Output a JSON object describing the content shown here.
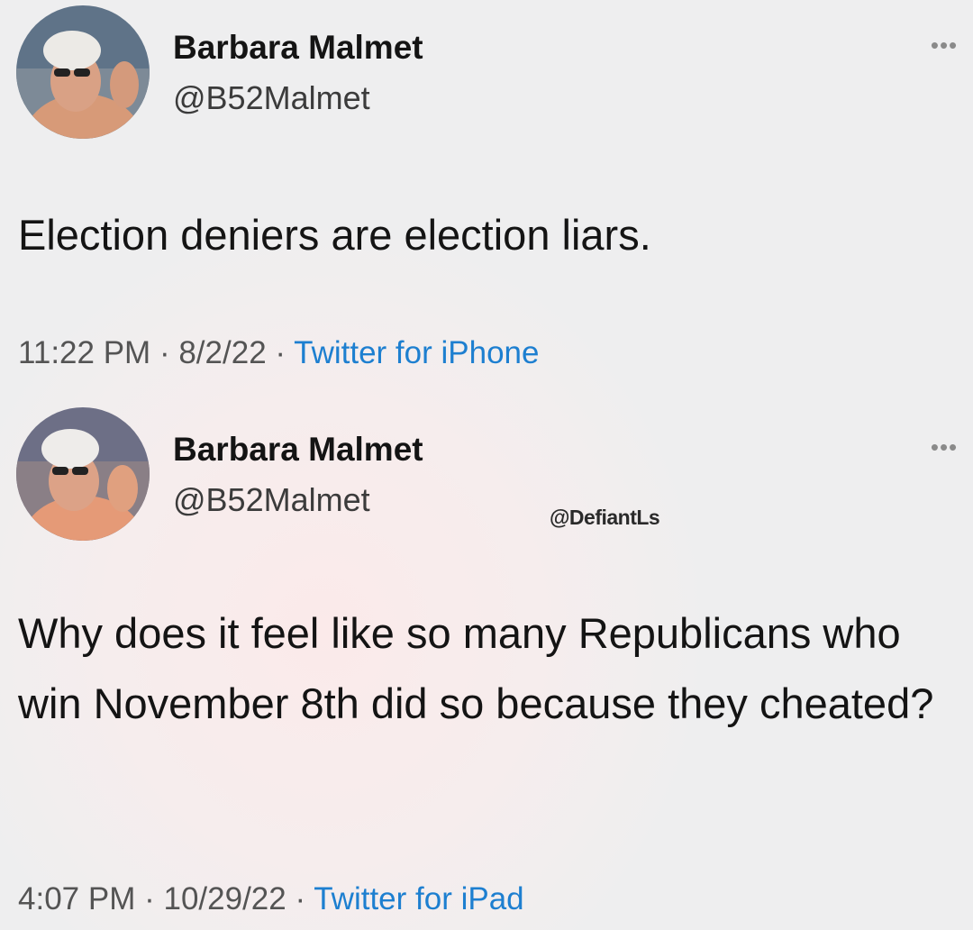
{
  "tweets": [
    {
      "author": {
        "name": "Barbara Malmet",
        "handle": "@B52Malmet"
      },
      "more_icon": "more-horizontal-icon",
      "more_glyph": "•••",
      "text": "Election deniers are election liars.",
      "time": "11:22 PM",
      "separator": "·",
      "date": "8/2/22",
      "source": "Twitter for iPhone"
    },
    {
      "author": {
        "name": "Barbara Malmet",
        "handle": "@B52Malmet"
      },
      "more_icon": "more-horizontal-icon",
      "more_glyph": "•••",
      "text": "Why does it feel like so many Republicans who win November 8th did so because they cheated?",
      "time": "4:07 PM",
      "separator": "·",
      "date": "10/29/22",
      "source": "Twitter for iPad"
    }
  ],
  "watermark": "@DefiantLs",
  "colors": {
    "source_link": "#1d7fd0",
    "text": "#141414",
    "meta": "#545454",
    "background": "#eeeeef",
    "tint": "#fbeaea"
  }
}
